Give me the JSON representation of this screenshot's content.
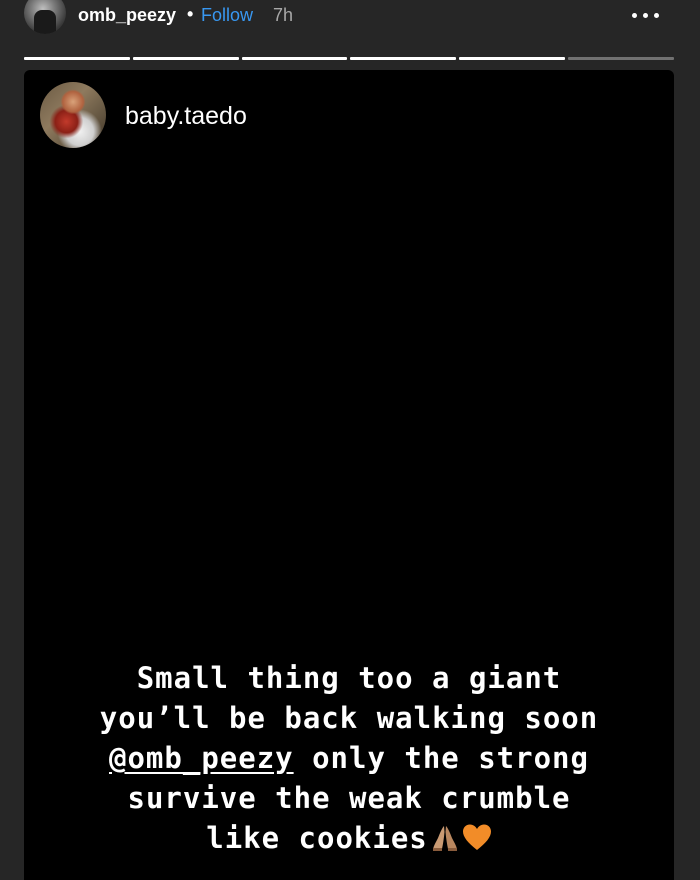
{
  "header": {
    "username": "omb_peezy",
    "separator": "•",
    "follow_label": "Follow",
    "time_ago": "7h"
  },
  "progress": {
    "segments": [
      1,
      1,
      1,
      1,
      1,
      0
    ]
  },
  "story": {
    "poster_name": "baby.taedo",
    "caption": {
      "line1": "Small thing too a giant",
      "line2": "you’ll be back walking soon",
      "line3_mention": "@omb_peezy",
      "line3_rest": " only the strong",
      "line4": "survive the weak crumble",
      "line5": "like cookies"
    },
    "emojis": [
      "folded-hands",
      "orange-heart"
    ]
  },
  "colors": {
    "background": "#262626",
    "story_background": "#000000",
    "follow_blue": "#3897f0",
    "heart_orange": "#f28c28"
  }
}
